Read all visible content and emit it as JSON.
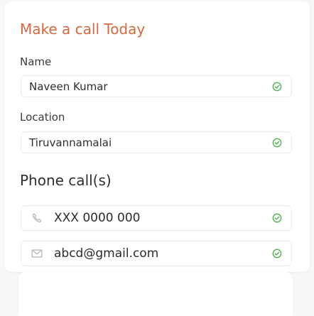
{
  "form": {
    "title": "Make a call Today",
    "name_label": "Name",
    "name_value": "Naveen Kumar",
    "location_label": "Location",
    "location_value": "Tiruvannamalai",
    "contact_section_label": "Phone call(s)",
    "phone_value": "XXX 0000 000",
    "email_value": "abcd@gmail.com"
  },
  "icons": {
    "check": "check-circle-icon",
    "phone": "phone-icon",
    "mail": "mail-icon"
  },
  "colors": {
    "accent_title": "#d9673d",
    "check_green": "#4caf50",
    "field_border": "#ececec",
    "muted_icon": "#b5b5b5"
  }
}
